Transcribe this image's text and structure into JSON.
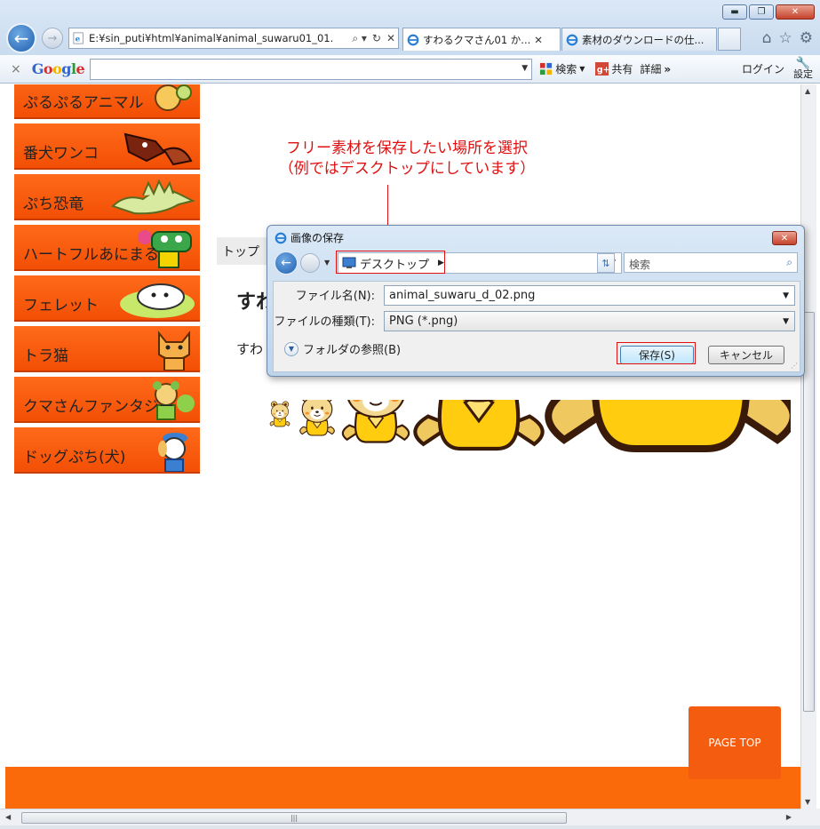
{
  "browser": {
    "window_controls": [
      "▬",
      "❐",
      "✕"
    ],
    "address": "E:¥sin_puti¥html¥animal¥animal_suwaru01_01.",
    "address_controls": [
      "⌕ ▾",
      "↻",
      "✕"
    ],
    "tabs": [
      {
        "label": "すわるクマさん01 か...",
        "close": "✕"
      },
      {
        "label": "素材のダウンロードの仕..."
      }
    ]
  },
  "google_bar": {
    "logo": "Google",
    "search_label": "検索",
    "share_label": "共有",
    "more_label": "詳細",
    "more_arrow": "»",
    "login_label": "ログイン",
    "settings_label": "設定"
  },
  "sidebar": {
    "items": [
      {
        "label": "ぷるぷるアニマル"
      },
      {
        "label": "番犬ワンコ"
      },
      {
        "label": "ぷち恐竜"
      },
      {
        "label": "ハートフルあにまる"
      },
      {
        "label": "フェレット"
      },
      {
        "label": "トラ猫"
      },
      {
        "label": "クマさんファンタジー"
      },
      {
        "label": "ドッグぷち(犬)"
      }
    ]
  },
  "main": {
    "breadcrumb": "トップ",
    "heading": "すわ",
    "body_text": "すわ"
  },
  "annotation": {
    "line1": "フリー素材を保存したい場所を選択",
    "line2": "（例ではデスクトップにしています）",
    "color": "#e01010"
  },
  "dialog": {
    "title": "画像の保存",
    "location": "デスクトップ",
    "search_placeholder": "検索",
    "filename_label": "ファイル名(N):",
    "filename_value": "animal_suwaru_d_02.png",
    "filetype_label": "ファイルの種類(T):",
    "filetype_value": "PNG (*.png)",
    "browse_folders": "フォルダの参照(B)",
    "save_button": "保存(S)",
    "cancel_button": "キャンセル"
  },
  "page_top_button": "PAGE TOP",
  "colors": {
    "accent_orange": "#f45d10",
    "sidebar_orange": "#f75a0d",
    "highlight_red": "#e01010"
  }
}
